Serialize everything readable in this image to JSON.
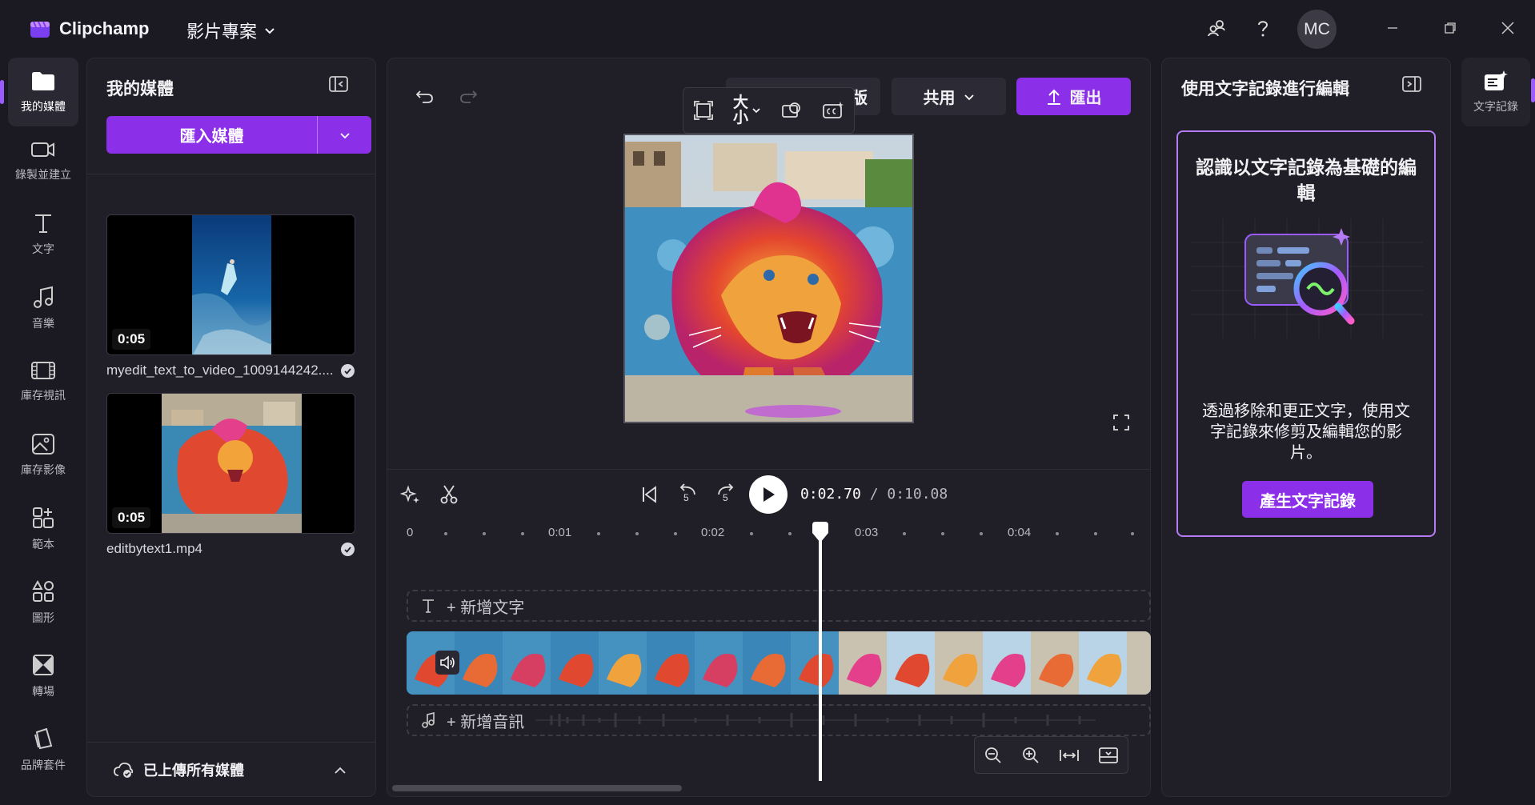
{
  "app": {
    "title": "Clipchamp",
    "project_name": "影片專案"
  },
  "titlebar": {
    "avatar_initials": "MC",
    "icons": [
      "share-people-icon",
      "help-icon",
      "minimize-icon",
      "restore-icon",
      "close-icon"
    ]
  },
  "leftnav": {
    "items": [
      {
        "label": "我的媒體",
        "icon": "folder-icon",
        "active": true
      },
      {
        "label": "錄製並建立",
        "icon": "camera-icon"
      },
      {
        "label": "文字",
        "icon": "text-icon"
      },
      {
        "label": "音樂",
        "icon": "music-icon"
      },
      {
        "label": "庫存視訊",
        "icon": "film-icon"
      },
      {
        "label": "庫存影像",
        "icon": "image-icon"
      },
      {
        "label": "範本",
        "icon": "template-icon"
      },
      {
        "label": "圖形",
        "icon": "shapes-icon"
      },
      {
        "label": "轉場",
        "icon": "transition-icon"
      },
      {
        "label": "品牌套件",
        "icon": "brand-kit-icon"
      }
    ]
  },
  "media": {
    "title": "我的媒體",
    "import_label": "匯入媒體",
    "items": [
      {
        "duration": "0:05",
        "filename": "myedit_text_to_video_1009144242....",
        "kind": "ocean"
      },
      {
        "duration": "0:05",
        "filename": "editbytext1.mp4",
        "kind": "lion"
      }
    ],
    "upload_status": "已上傳所有媒體"
  },
  "editor": {
    "share_label": "共用",
    "export_label": "匯出",
    "hidden_button_fragment": "版",
    "float_toolbar": {
      "size_label_line1": "大",
      "size_label_line2": "小"
    },
    "current_time": "0:02.70",
    "total_time": "/ 0:10.08",
    "skip_back": "5",
    "skip_forward": "5",
    "ruler": [
      "0",
      "0:01",
      "0:02",
      "0:03",
      "0:04"
    ],
    "add_text_label": "+ 新增文字",
    "add_audio_label": "+ 新增音訊"
  },
  "transcript": {
    "panel_title": "使用文字記錄進行編輯",
    "card_title": "認識以文字記錄為基礎的編輯",
    "card_desc": "透過移除和更正文字，使用文字記錄來修剪及編輯您的影片。",
    "button_label": "產生文字記錄",
    "rail_label": "文字記錄"
  },
  "colors": {
    "accent": "#8c2fe8",
    "background": "#1b1a22",
    "panel": "#201f28"
  }
}
